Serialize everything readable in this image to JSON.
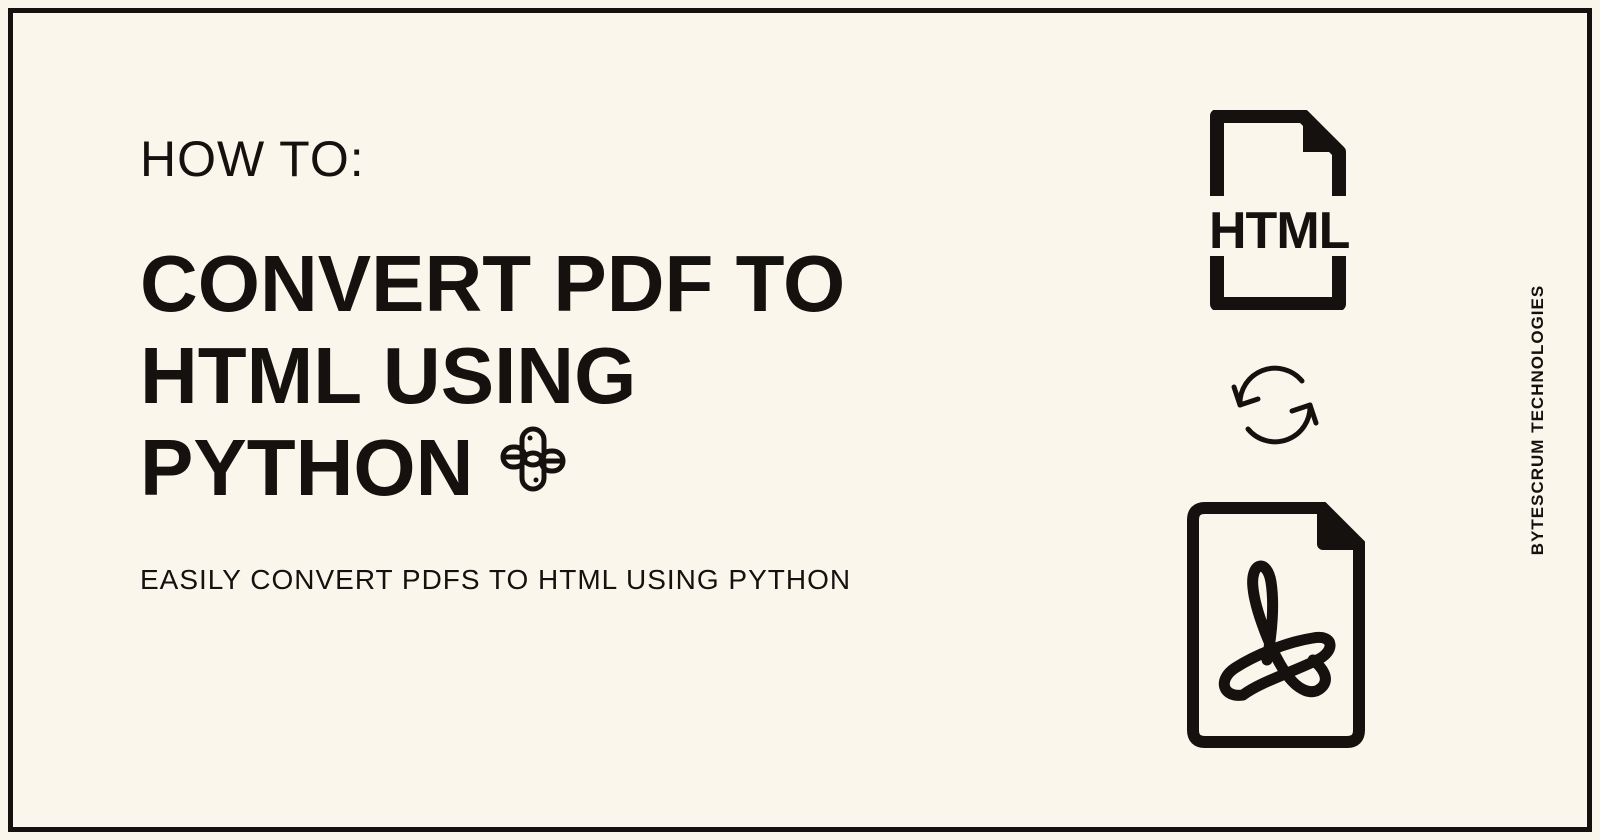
{
  "eyebrow": "HOW TO:",
  "headline_line1": "CONVERT PDF TO",
  "headline_line2": "HTML USING",
  "headline_line3": "PYTHON",
  "subhead": "EASILY CONVERT PDFS TO HTML USING PYTHON",
  "sidetext": "BYTESCRUM TECHNOLOGIES",
  "html_file_label": "HTML",
  "icons": {
    "python": "python-icon",
    "html_file": "html-file-icon",
    "refresh": "refresh-icon",
    "pdf_file": "pdf-file-icon"
  }
}
